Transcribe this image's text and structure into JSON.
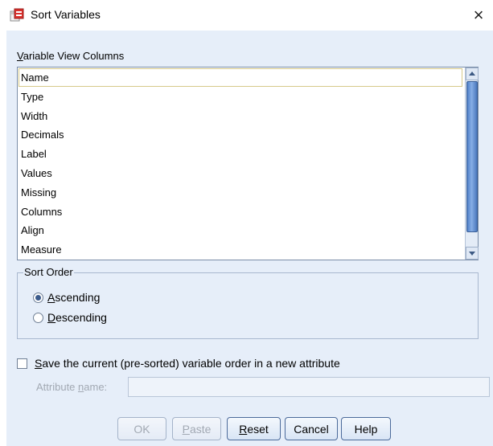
{
  "window": {
    "title": "Sort Variables",
    "close_glyph": "×",
    "icon": "spss-dialog-icon"
  },
  "columns_section": {
    "label_prefix": "",
    "label_accel": "V",
    "label_rest": "ariable View Columns",
    "items": [
      "Name",
      "Type",
      "Width",
      "Decimals",
      "Label",
      "Values",
      "Missing",
      "Columns",
      "Align",
      "Measure"
    ],
    "focused_index": 0
  },
  "sort_order": {
    "legend": "Sort Order",
    "options": [
      {
        "accel": "A",
        "rest": "scending",
        "checked": true
      },
      {
        "accel": "D",
        "rest": "escending",
        "checked": false
      }
    ]
  },
  "save_order": {
    "accel": "S",
    "rest": "ave the current (pre-sorted) variable order in a new attribute",
    "checked": false
  },
  "attribute_name": {
    "label_prefix": "Attribute ",
    "label_accel": "n",
    "label_rest": "ame:",
    "value": "",
    "enabled": false
  },
  "buttons": {
    "ok": {
      "label": "OK",
      "enabled": false
    },
    "paste": {
      "accel": "P",
      "rest": "aste",
      "enabled": false
    },
    "reset": {
      "accel": "R",
      "rest": "eset",
      "enabled": true
    },
    "cancel": {
      "label": "Cancel",
      "enabled": true
    },
    "help": {
      "label": "Help",
      "enabled": true
    }
  },
  "colors": {
    "dialog_background": "#e6eef9",
    "scroll_thumb": "#5b8bd0",
    "disabled_text": "#a2a9b3"
  }
}
